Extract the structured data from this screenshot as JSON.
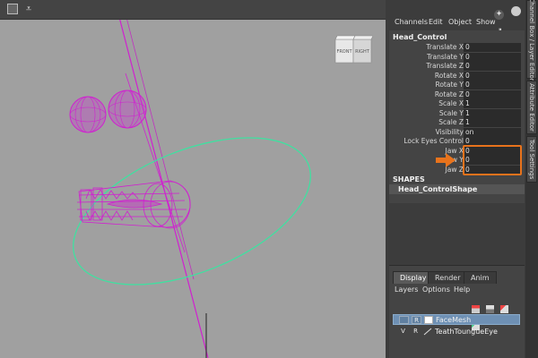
{
  "viewport": {
    "viewcube": {
      "front_label": "FRONT",
      "side_label": "RIGHT"
    },
    "toolbar_icons": [
      "square-icon",
      "share-icon"
    ]
  },
  "channel_box": {
    "top_icons": [
      "axis-icon",
      "circle-icon",
      "eyedropper-icon"
    ],
    "menu": [
      "Channels",
      "Edit",
      "Object",
      "Show"
    ],
    "node_name": "Head_Control",
    "attributes": [
      {
        "label": "Translate X",
        "value": "0"
      },
      {
        "label": "Translate Y",
        "value": "0"
      },
      {
        "label": "Translate Z",
        "value": "0"
      },
      {
        "label": "Rotate X",
        "value": "0"
      },
      {
        "label": "Rotate Y",
        "value": "0"
      },
      {
        "label": "Rotate Z",
        "value": "0"
      },
      {
        "label": "Scale X",
        "value": "1"
      },
      {
        "label": "Scale Y",
        "value": "1"
      },
      {
        "label": "Scale Z",
        "value": "1"
      },
      {
        "label": "Visibility",
        "value": "on"
      },
      {
        "label": "Lock Eyes Control",
        "value": "0"
      },
      {
        "label": "Jaw X",
        "value": "0"
      },
      {
        "label": "Jaw Y",
        "value": "0"
      },
      {
        "label": "Jaw Z",
        "value": "0"
      }
    ],
    "shapes_header": "SHAPES",
    "shape_name": "Head_ControlShape",
    "highlight_color": "#e8731c"
  },
  "side_tabs": [
    "Channel Box / Layer Editor",
    "Attribute Editor",
    "Tool Settings"
  ],
  "layer_editor": {
    "tabs": [
      "Display",
      "Render",
      "Anim"
    ],
    "menu": [
      "Layers",
      "Options",
      "Help"
    ],
    "layers": [
      {
        "v": "",
        "r": "R",
        "name": "FaceMesh",
        "selected": true
      },
      {
        "v": "V",
        "r": "R",
        "name": "TeathToungueEye",
        "selected": false
      }
    ]
  }
}
